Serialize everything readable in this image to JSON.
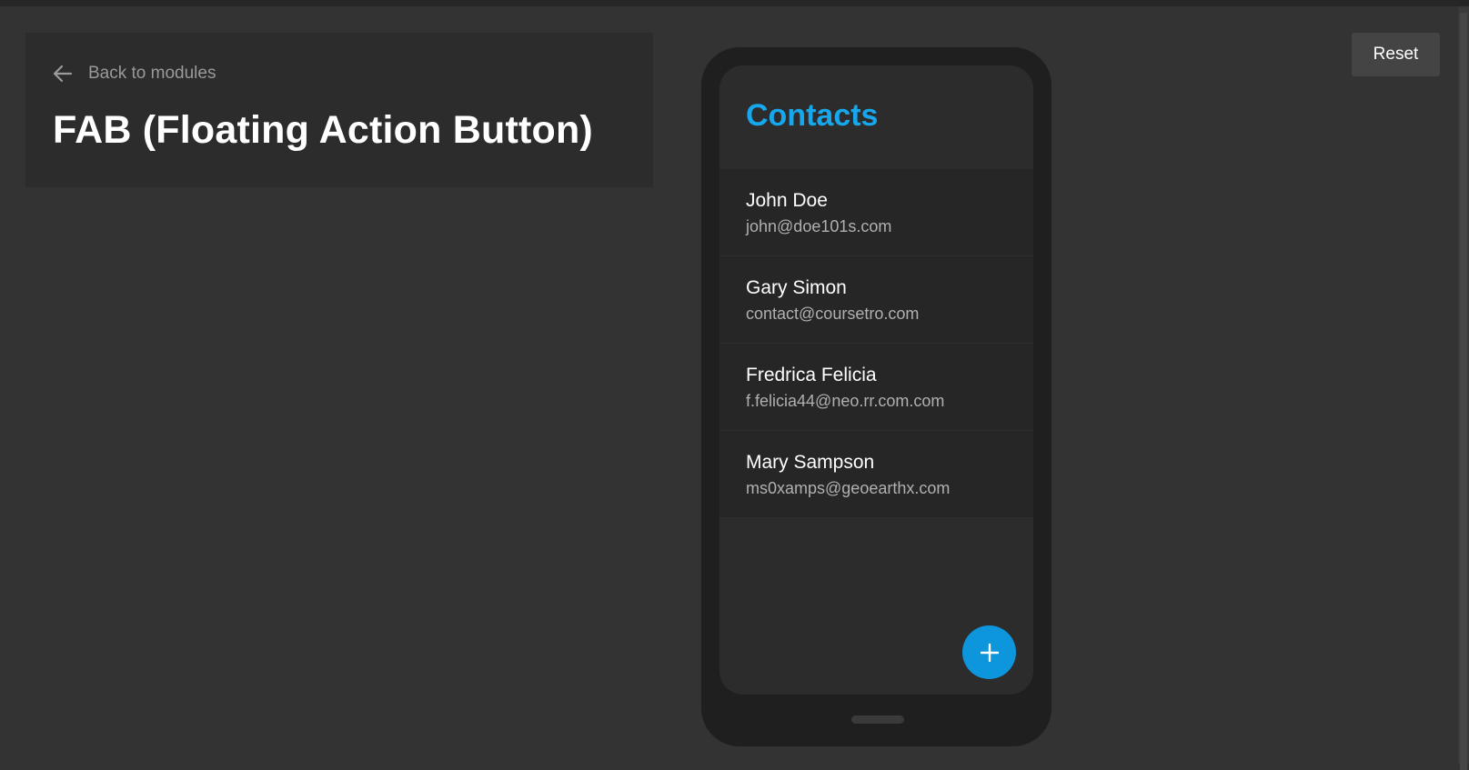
{
  "header": {
    "back_label": "Back to modules",
    "title": "FAB (Floating Action Button)"
  },
  "toolbar": {
    "reset_label": "Reset"
  },
  "phone": {
    "screen_title": "Contacts",
    "contacts": [
      {
        "name": "John Doe",
        "email": "john@doe101s.com"
      },
      {
        "name": "Gary Simon",
        "email": "contact@coursetro.com"
      },
      {
        "name": "Fredrica Felicia",
        "email": "f.felicia44@neo.rr.com.com"
      },
      {
        "name": "Mary Sampson",
        "email": "ms0xamps@geoearthx.com"
      }
    ],
    "fab_icon": "plus-icon"
  },
  "colors": {
    "background": "#333333",
    "card": "#2c2c2c",
    "accent": "#16a7ec",
    "fab": "#0d96db",
    "phone_frame": "#1f1f1f"
  }
}
